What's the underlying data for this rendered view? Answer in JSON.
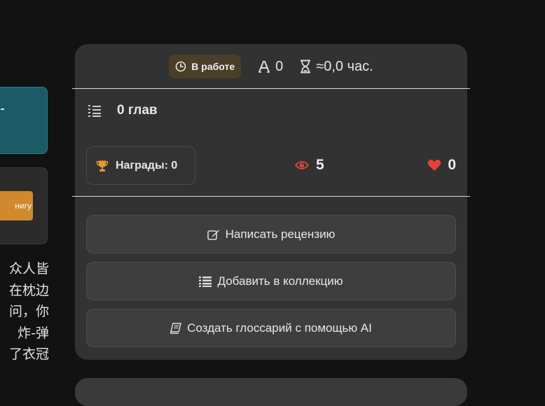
{
  "left": {
    "card_button_label": "нигу",
    "text_lines": [
      "众人皆",
      "在枕边",
      "问，你",
      "炸-弹",
      "了衣冠"
    ]
  },
  "status": {
    "badge_label": "В работе",
    "letters_count": "0",
    "reading_time": "≈0,0 час."
  },
  "chapters_label": "0 глав",
  "awards_label": "Награды: 0",
  "views_count": "5",
  "likes_count": "0",
  "actions": {
    "write_review": "Написать рецензию",
    "add_to_collection": "Добавить в коллекцию",
    "create_glossary": "Создать глоссарий с помощью AI"
  },
  "colors": {
    "accent_orange": "#d08a2d",
    "eye_red": "#e0473b",
    "heart_red": "#e8413a",
    "trophy_gold": "#e29b2f"
  }
}
